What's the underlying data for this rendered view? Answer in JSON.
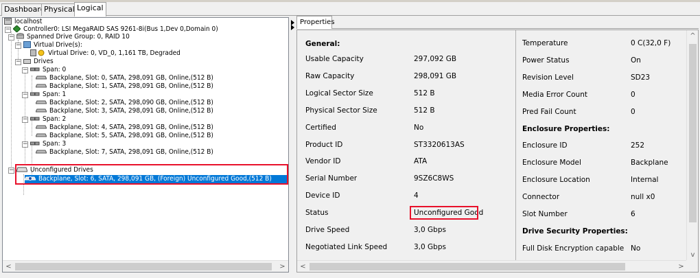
{
  "tabs": [
    "Dashboard",
    "Physical",
    "Logical"
  ],
  "tree": {
    "host": "localhost",
    "controller": "Controller0: LSI MegaRAID SAS 9261-8i(Bus 1,Dev 0,Domain 0)",
    "drive_group": "Spanned Drive Group: 0, RAID  10",
    "virtual_drives_label": "Virtual Drive(s):",
    "virtual_drive": "Virtual Drive: 0, VD_0, 1,161 TB, Degraded",
    "drives_label": "Drives",
    "spans": [
      {
        "label": "Span: 0",
        "drives": [
          "Backplane, Slot: 0, SATA, 298,091 GB, Online,(512 B)",
          "Backplane, Slot: 1, SATA, 298,091 GB, Online,(512 B)"
        ]
      },
      {
        "label": "Span: 1",
        "drives": [
          "Backplane, Slot: 2, SATA, 298,090 GB, Online,(512 B)",
          "Backplane, Slot: 3, SATA, 298,091 GB, Online,(512 B)"
        ]
      },
      {
        "label": "Span: 2",
        "drives": [
          "Backplane, Slot: 4, SATA, 298,091 GB, Online,(512 B)",
          "Backplane, Slot: 5, SATA, 298,091 GB, Online,(512 B)"
        ]
      },
      {
        "label": "Span: 3",
        "drives": [
          "Backplane, Slot: 7, SATA, 298,091 GB, Online,(512 B)"
        ]
      }
    ],
    "unconfigured_label": "Unconfigured Drives",
    "unconfigured_drive": "Backplane, Slot: 6, SATA, 298,091 GB, (Foreign) Unconfigured Good,(512 B)"
  },
  "properties": {
    "tab_label": "Properties",
    "general_header": "General:",
    "left": [
      {
        "k": "Usable Capacity",
        "v": "297,092 GB"
      },
      {
        "k": "Raw Capacity",
        "v": "298,091 GB"
      },
      {
        "k": "Logical Sector Size",
        "v": "512 B"
      },
      {
        "k": "Physical Sector Size",
        "v": "512 B"
      },
      {
        "k": "Certified",
        "v": "No"
      },
      {
        "k": "Product ID",
        "v": "ST3320613AS"
      },
      {
        "k": "Vendor ID",
        "v": "ATA"
      },
      {
        "k": "Serial Number",
        "v": "9SZ6C8WS"
      },
      {
        "k": "Device ID",
        "v": "4"
      },
      {
        "k": "Status",
        "v": "Unconfigured Good"
      },
      {
        "k": "Drive Speed",
        "v": "3,0 Gbps"
      },
      {
        "k": "Negotiated Link Speed",
        "v": "3,0 Gbps"
      }
    ],
    "right": [
      {
        "k": "Temperature",
        "v": "0 C(32,0 F)"
      },
      {
        "k": "Power Status",
        "v": "On"
      },
      {
        "k": "Revision Level",
        "v": "SD23"
      },
      {
        "k": "Media Error Count",
        "v": "0"
      },
      {
        "k": "Pred Fail Count",
        "v": "0"
      },
      {
        "k": "Enclosure Properties:",
        "v": "",
        "header": true
      },
      {
        "k": "Enclosure ID",
        "v": "252"
      },
      {
        "k": "Enclosure Model",
        "v": "Backplane"
      },
      {
        "k": "Enclosure Location",
        "v": "Internal"
      },
      {
        "k": "Connector",
        "v": "null x0"
      },
      {
        "k": "Slot Number",
        "v": "6"
      },
      {
        "k": "Drive Security Properties:",
        "v": "",
        "header": true
      },
      {
        "k": "Full Disk Encryption capable",
        "v": "No"
      }
    ]
  },
  "colors": {
    "highlight": "#e8102a",
    "selection": "#0078d7"
  }
}
